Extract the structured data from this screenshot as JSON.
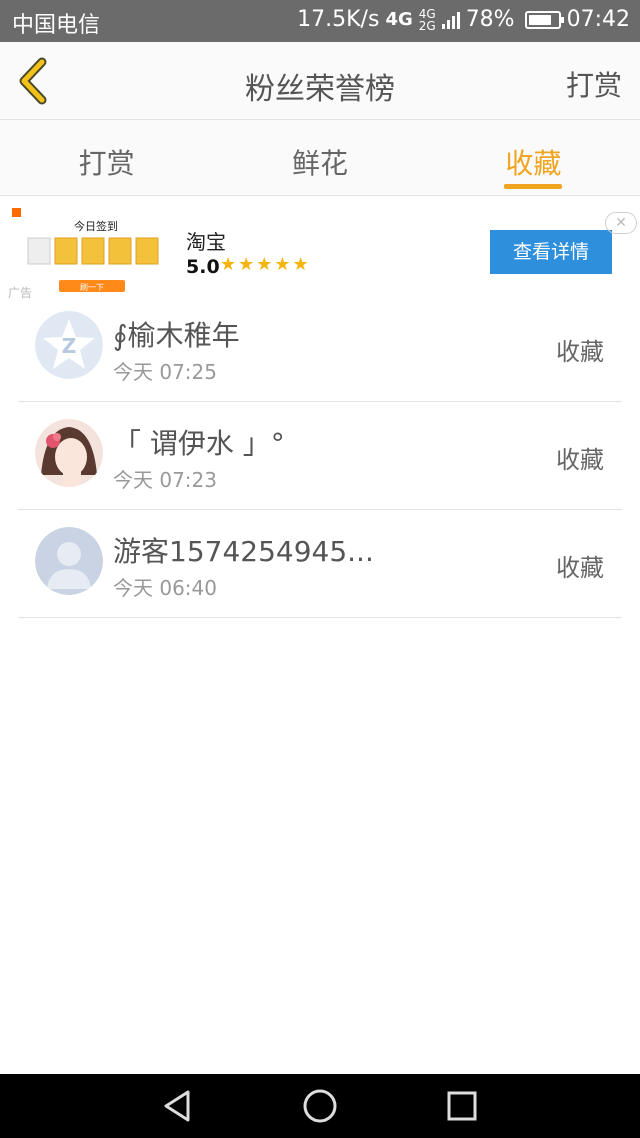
{
  "status_bar": {
    "carrier": "中国电信",
    "speed": "17.5K/s",
    "network_main": "4G",
    "network_small_top": "4G",
    "network_small_bottom": "2G",
    "battery": "78%",
    "battery_level": 0.78,
    "time": "07:42"
  },
  "header": {
    "title": "粉丝荣誉榜",
    "action": "打赏",
    "back_icon": "chevron-left-icon",
    "accent_color": "#f0a420"
  },
  "tabs": [
    {
      "label": "打赏",
      "active": false
    },
    {
      "label": "鲜花",
      "active": false
    },
    {
      "label": "收藏",
      "active": true
    }
  ],
  "ad": {
    "thumb_title": "今日签到",
    "thumb_button": "刷一下",
    "source": "广告",
    "app_name": "淘宝",
    "rating": "5.0",
    "stars": "★★★★★",
    "cta": "查看详情",
    "close": "✕",
    "cta_color": "#2e8fdc"
  },
  "list": [
    {
      "name": "∮榆木稚年",
      "time": "今天 07:25",
      "type": "收藏",
      "avatar": "qq-default-avatar"
    },
    {
      "name": "「 谓伊水 」°",
      "time": "今天 07:23",
      "type": "收藏",
      "avatar": "anime-girl-avatar"
    },
    {
      "name": "游客1574254945...",
      "time": "今天 06:40",
      "type": "收藏",
      "avatar": "guest-default-avatar"
    }
  ],
  "nav_bar": {
    "back": "triangle-back-icon",
    "home": "circle-home-icon",
    "recents": "square-recents-icon"
  }
}
